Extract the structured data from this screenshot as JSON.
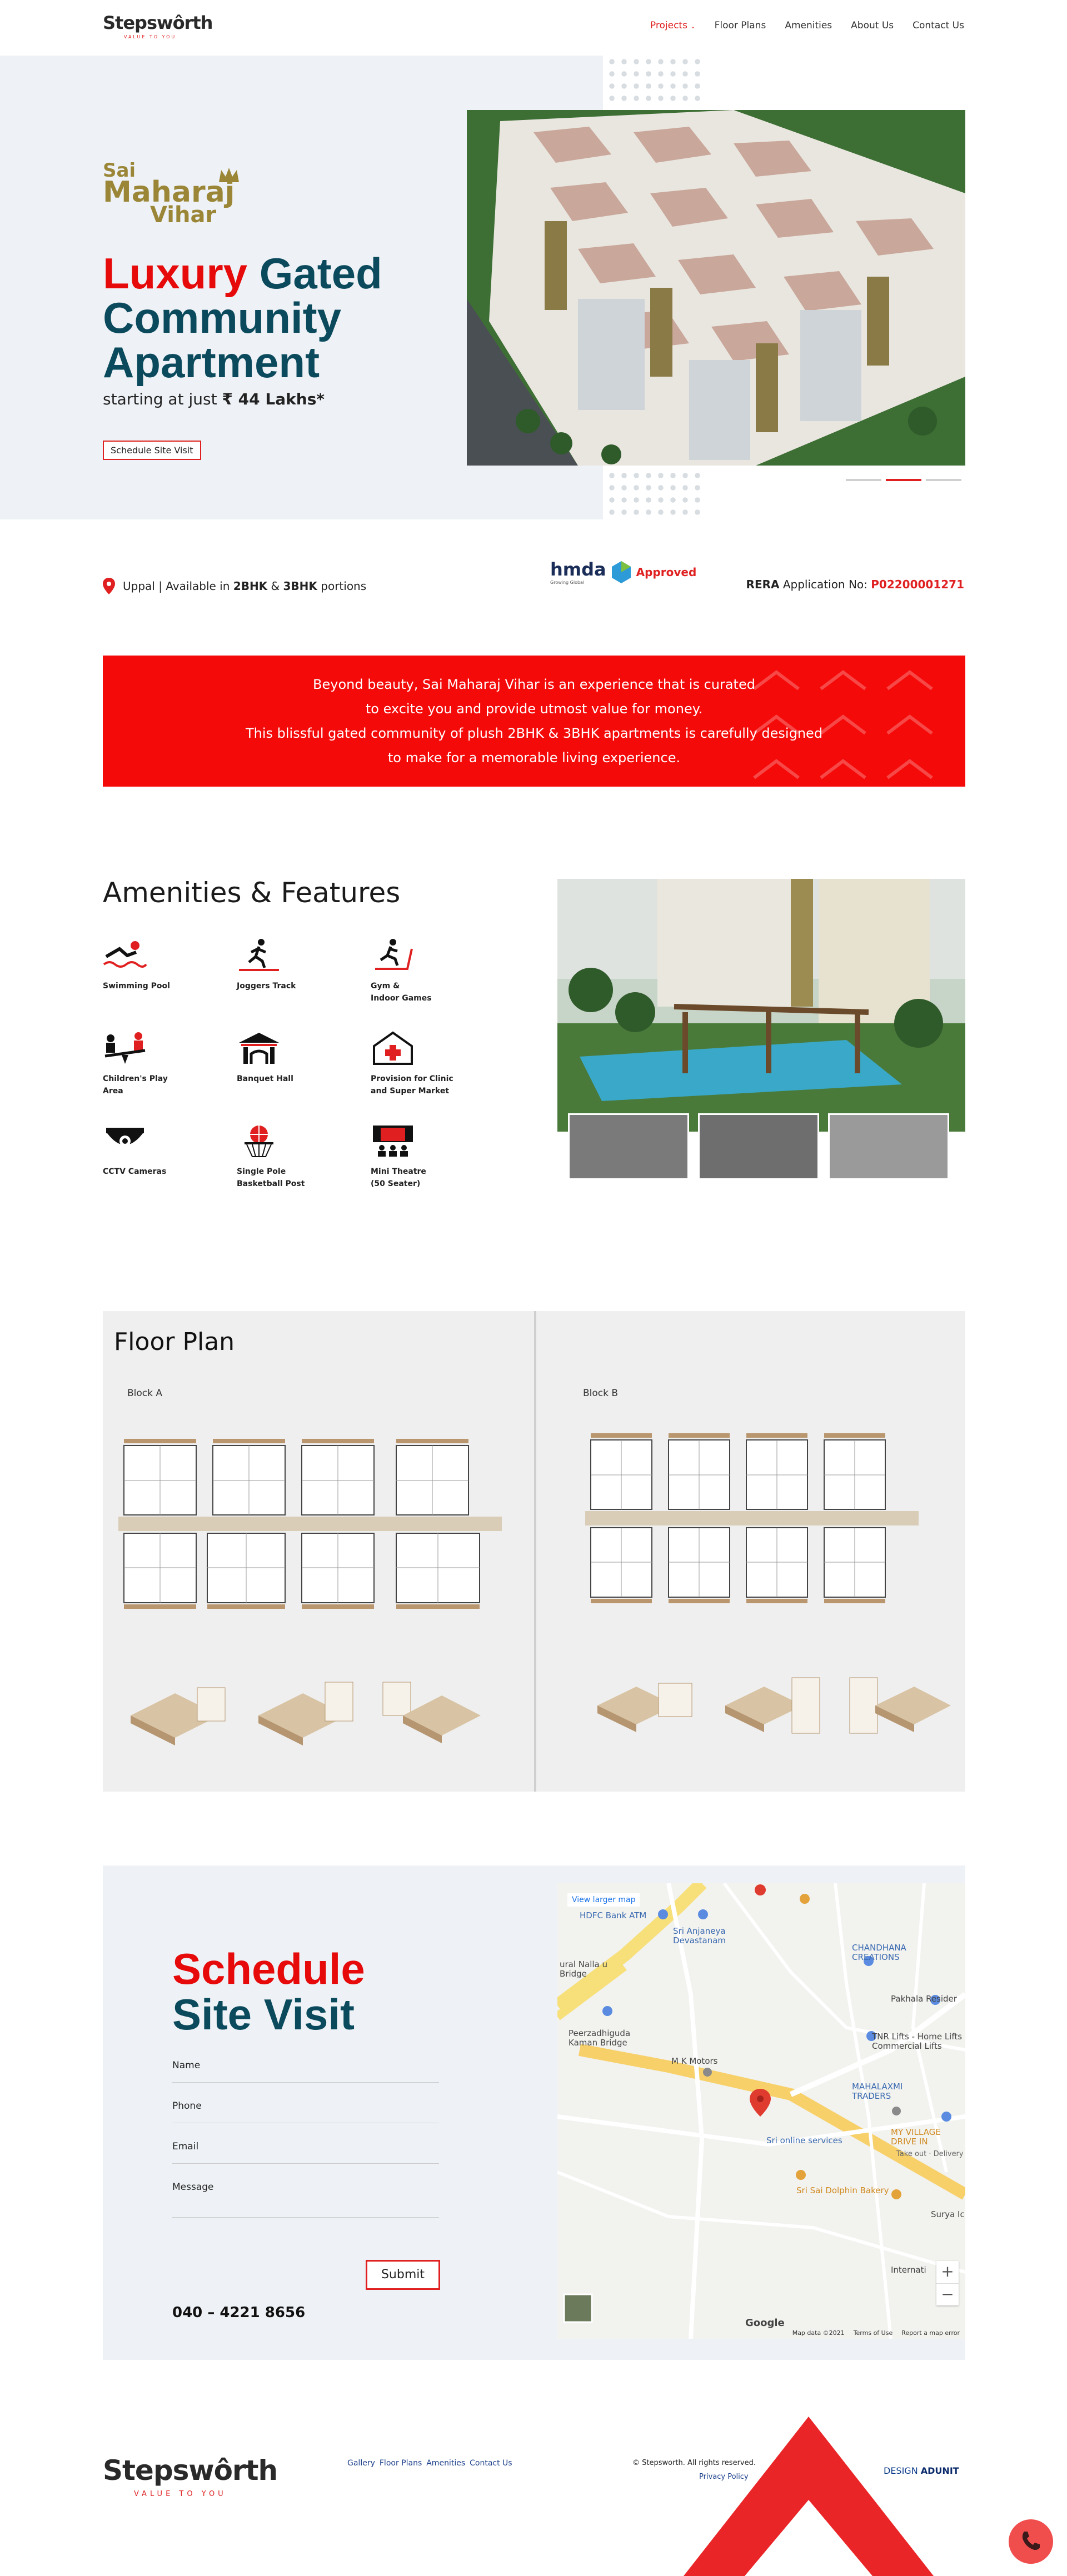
{
  "header": {
    "logo": "Stepswôrth",
    "logo_tag": "VALUE TO YOU",
    "nav": [
      "Projects",
      "Floor Plans",
      "Amenities",
      "About Us",
      "Contact Us"
    ]
  },
  "hero": {
    "brand": [
      "Sai",
      "Maharaj",
      "Vihar"
    ],
    "title_red": "Luxury",
    "title_rest1": " Gated",
    "title_line2": "Community",
    "title_line3": "Apartment",
    "sub_prefix": "starting at just ",
    "sub_price": "₹ 44 Lakhs*",
    "button": "Schedule Site Visit",
    "slider_active": 1
  },
  "info": {
    "location_prefix": "Uppal | Available in ",
    "bhk1": "2BHK",
    "amp": " & ",
    "bhk2": "3BHK",
    "location_suffix": " portions",
    "hmda": "hmda",
    "hmda_sub": "Growing Global",
    "approved": "Approved",
    "rera_label": "RERA",
    "rera_text": " Application No: ",
    "rera_no": "P02200001271"
  },
  "banner": {
    "lines": [
      "Beyond beauty, Sai Maharaj Vihar is an experience that is curated",
      "to excite you and provide utmost value for money.",
      "This blissful gated community of plush 2BHK & 3BHK apartments is carefully designed",
      "to make for a memorable living experience."
    ]
  },
  "amenities": {
    "title": "Amenities & Features",
    "items": [
      {
        "label": "Swimming Pool",
        "icon": "swimming-icon"
      },
      {
        "label": "Joggers Track",
        "icon": "jogger-icon"
      },
      {
        "label": "Gym &\nIndoor Games",
        "icon": "treadmill-icon"
      },
      {
        "label": "Children's Play\nArea",
        "icon": "seesaw-icon"
      },
      {
        "label": "Banquet Hall",
        "icon": "hall-icon"
      },
      {
        "label": "Provision for Clinic\nand Super Market",
        "icon": "clinic-icon"
      },
      {
        "label": "CCTV Cameras",
        "icon": "cctv-icon"
      },
      {
        "label": "Single Pole\nBasketball Post",
        "icon": "basketball-icon"
      },
      {
        "label": "Mini Theatre\n(50 Seater)",
        "icon": "theatre-icon"
      }
    ]
  },
  "floor": {
    "title": "Floor Plan",
    "block_a": "Block A",
    "block_b": "Block B"
  },
  "schedule": {
    "title_red": "Schedule",
    "title_blue": "Site Visit",
    "fields": [
      "Name",
      "Phone",
      "Email",
      "Message"
    ],
    "submit": "Submit",
    "phone": "040 – 4221 8656"
  },
  "map": {
    "view_larger": "View larger map",
    "labels": [
      "HDFC Bank ATM",
      "Sri Anjaneya Devastanam",
      "CHANDHANA CREATIONS",
      "Pakhala Resider",
      "Peerzadhiguda Kaman Bridge",
      "M K Motors",
      "TNR Lifts - Home Lifts Commercial Lifts",
      "MAHALAXMI TRADERS",
      "MY VILLAGE DRIVE IN",
      "Take out · Delivery",
      "Sri online services",
      "Sri Sai Dolphin Bakery",
      "Internati",
      "Surya Ic",
      "ural Nalla u Bridge"
    ],
    "google": "Google",
    "footer": [
      "Map data ©2021",
      "Terms of Use",
      "Report a map error"
    ]
  },
  "footer": {
    "logo": "Stepswôrth",
    "tag": "VALUE TO YOU",
    "links": [
      "Gallery",
      "Floor Plans",
      "Amenities",
      "Contact Us"
    ],
    "copyright": "© Stepsworth. All rights reserved.",
    "privacy": "Privacy Policy",
    "design_prefix": "DESIGN ",
    "design_brand": "ADUNIT"
  },
  "colors": {
    "red": "#e60a0a",
    "teal": "#0a4a5c",
    "gold": "#9a8636"
  }
}
